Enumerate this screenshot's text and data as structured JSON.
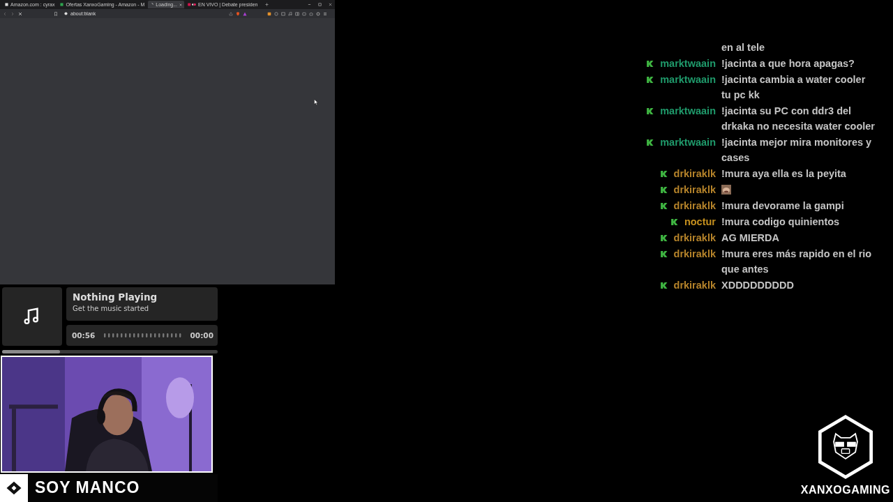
{
  "browser": {
    "tabs": [
      {
        "title": "Amazon.com : cyrax",
        "selected": false,
        "kind": "page"
      },
      {
        "title": "Ofertas XanxoGaming - Amazon - M",
        "selected": false,
        "kind": "sheet"
      },
      {
        "title": "Loading...",
        "selected": true,
        "kind": "loading"
      },
      {
        "title": "EN VIVO | Debate presiden",
        "selected": false,
        "kind": "live"
      }
    ],
    "address": "about:blank"
  },
  "music": {
    "title": "Nothing Playing",
    "subtitle": "Get the music started",
    "elapsed": "00:56",
    "remaining": "00:00",
    "level": 0.27
  },
  "name_bar": {
    "name": "SOY MANCO"
  },
  "chat": [
    {
      "kind": "continuation",
      "text": "en al tele"
    },
    {
      "kind": "text",
      "user": "marktwaain",
      "color": "#1f9a6b",
      "text": "!jacinta a que hora apagas?"
    },
    {
      "kind": "text",
      "user": "marktwaain",
      "color": "#1f9a6b",
      "text": "!jacinta cambia a water cooler tu pc kk"
    },
    {
      "kind": "text",
      "user": "marktwaain",
      "color": "#1f9a6b",
      "text": "!jacinta su PC con ddr3 del drkaka no necesita water cooler"
    },
    {
      "kind": "text",
      "user": "marktwaain",
      "color": "#1f9a6b",
      "text": "!jacinta mejor mira monitores y cases"
    },
    {
      "kind": "text",
      "user": "drkiraklk",
      "color": "#b5832a",
      "text": "!mura aya ella es la peyita"
    },
    {
      "kind": "emote",
      "user": "drkiraklk",
      "color": "#b5832a"
    },
    {
      "kind": "text",
      "user": "drkiraklk",
      "color": "#b5832a",
      "text": "!mura devorame la gampi"
    },
    {
      "kind": "text",
      "user": "noctur",
      "color": "#c48f1e",
      "text": "!mura codigo quinientos"
    },
    {
      "kind": "text",
      "user": "drkiraklk",
      "color": "#b5832a",
      "text": "AG MIERDA"
    },
    {
      "kind": "text",
      "user": "drkiraklk",
      "color": "#b5832a",
      "text": "!mura eres más rapido en el rio que antes"
    },
    {
      "kind": "text",
      "user": "drkiraklk",
      "color": "#b5832a",
      "text": "XDDDDDDDDD"
    }
  ],
  "logo": {
    "name": "XANXOGAMING"
  }
}
